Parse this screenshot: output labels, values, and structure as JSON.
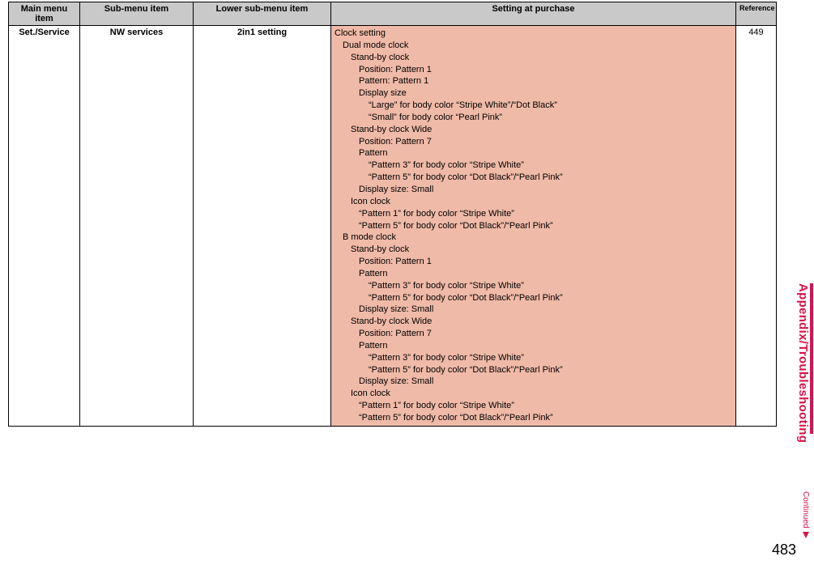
{
  "headers": {
    "main_menu": "Main menu item",
    "sub_menu": "Sub-menu item",
    "lower_sub_menu": "Lower sub-menu item",
    "setting": "Setting at purchase",
    "reference": "Reference"
  },
  "row": {
    "main_menu": "Set./Service",
    "sub_menu": "NW services",
    "lower_sub_menu": "2in1 setting",
    "reference": "449"
  },
  "setting_lines": [
    {
      "indent": 1,
      "text": "Clock setting"
    },
    {
      "indent": 2,
      "text": "Dual mode clock"
    },
    {
      "indent": 3,
      "text": "Stand-by clock"
    },
    {
      "indent": 4,
      "text": "Position: Pattern 1"
    },
    {
      "indent": 4,
      "text": "Pattern: Pattern 1"
    },
    {
      "indent": 4,
      "text": "Display size"
    },
    {
      "indent": 5,
      "text": "“Large” for body color “Stripe White”/“Dot Black”"
    },
    {
      "indent": 5,
      "text": "“Small” for body color “Pearl Pink”"
    },
    {
      "indent": 3,
      "text": "Stand-by clock Wide"
    },
    {
      "indent": 4,
      "text": "Position: Pattern 7"
    },
    {
      "indent": 4,
      "text": "Pattern"
    },
    {
      "indent": 5,
      "text": "“Pattern 3” for body color “Stripe White”"
    },
    {
      "indent": 5,
      "text": "“Pattern 5” for body color “Dot Black”/“Pearl Pink”"
    },
    {
      "indent": 4,
      "text": "Display size: Small"
    },
    {
      "indent": 3,
      "text": "Icon clock"
    },
    {
      "indent": 4,
      "text": "“Pattern 1” for body color “Stripe White”"
    },
    {
      "indent": 4,
      "text": "“Pattern 5” for body color “Dot Black”/“Pearl Pink”"
    },
    {
      "indent": 2,
      "text": "B mode clock"
    },
    {
      "indent": 3,
      "text": "Stand-by clock"
    },
    {
      "indent": 4,
      "text": "Position: Pattern 1"
    },
    {
      "indent": 4,
      "text": "Pattern"
    },
    {
      "indent": 5,
      "text": "“Pattern 3” for body color “Stripe White”"
    },
    {
      "indent": 5,
      "text": "“Pattern 5” for body color “Dot Black”/“Pearl Pink”"
    },
    {
      "indent": 4,
      "text": "Display size: Small"
    },
    {
      "indent": 3,
      "text": "Stand-by clock Wide"
    },
    {
      "indent": 4,
      "text": "Position: Pattern 7"
    },
    {
      "indent": 4,
      "text": "Pattern"
    },
    {
      "indent": 5,
      "text": "“Pattern 3” for body color “Stripe White”"
    },
    {
      "indent": 5,
      "text": "“Pattern 5” for body color “Dot Black”/“Pearl Pink”"
    },
    {
      "indent": 4,
      "text": "Display size: Small"
    },
    {
      "indent": 3,
      "text": "Icon clock"
    },
    {
      "indent": 4,
      "text": "“Pattern 1” for body color “Stripe White”"
    },
    {
      "indent": 4,
      "text": "“Pattern 5” for body color “Dot Black”/“Pearl Pink”"
    }
  ],
  "side_tab": "Appendix/Troubleshooting",
  "continued": "Continued",
  "page_number": "483"
}
